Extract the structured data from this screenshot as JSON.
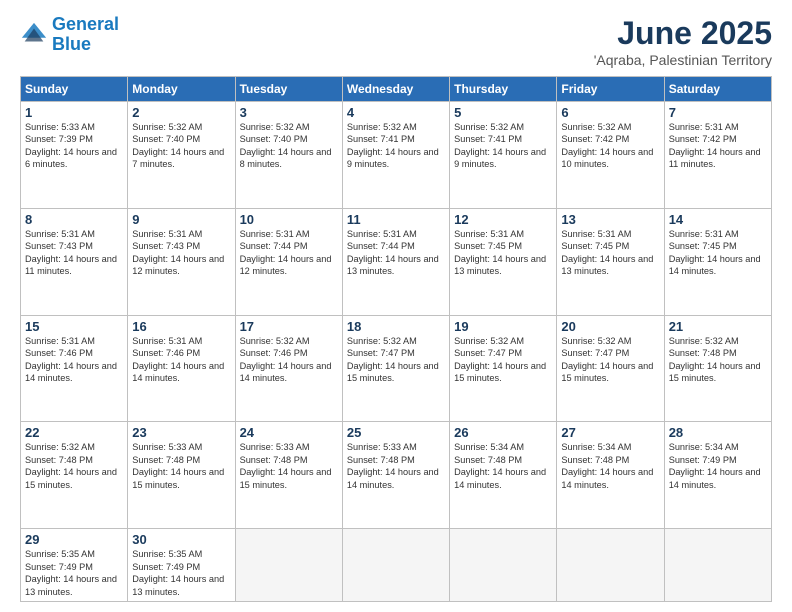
{
  "logo": {
    "line1": "General",
    "line2": "Blue"
  },
  "title": "June 2025",
  "location": "'Aqraba, Palestinian Territory",
  "days_of_week": [
    "Sunday",
    "Monday",
    "Tuesday",
    "Wednesday",
    "Thursday",
    "Friday",
    "Saturday"
  ],
  "weeks": [
    [
      {
        "day": "1",
        "sunrise": "5:33 AM",
        "sunset": "7:39 PM",
        "daylight": "14 hours and 6 minutes."
      },
      {
        "day": "2",
        "sunrise": "5:32 AM",
        "sunset": "7:40 PM",
        "daylight": "14 hours and 7 minutes."
      },
      {
        "day": "3",
        "sunrise": "5:32 AM",
        "sunset": "7:40 PM",
        "daylight": "14 hours and 8 minutes."
      },
      {
        "day": "4",
        "sunrise": "5:32 AM",
        "sunset": "7:41 PM",
        "daylight": "14 hours and 9 minutes."
      },
      {
        "day": "5",
        "sunrise": "5:32 AM",
        "sunset": "7:41 PM",
        "daylight": "14 hours and 9 minutes."
      },
      {
        "day": "6",
        "sunrise": "5:32 AM",
        "sunset": "7:42 PM",
        "daylight": "14 hours and 10 minutes."
      },
      {
        "day": "7",
        "sunrise": "5:31 AM",
        "sunset": "7:42 PM",
        "daylight": "14 hours and 11 minutes."
      }
    ],
    [
      {
        "day": "8",
        "sunrise": "5:31 AM",
        "sunset": "7:43 PM",
        "daylight": "14 hours and 11 minutes."
      },
      {
        "day": "9",
        "sunrise": "5:31 AM",
        "sunset": "7:43 PM",
        "daylight": "14 hours and 12 minutes."
      },
      {
        "day": "10",
        "sunrise": "5:31 AM",
        "sunset": "7:44 PM",
        "daylight": "14 hours and 12 minutes."
      },
      {
        "day": "11",
        "sunrise": "5:31 AM",
        "sunset": "7:44 PM",
        "daylight": "14 hours and 13 minutes."
      },
      {
        "day": "12",
        "sunrise": "5:31 AM",
        "sunset": "7:45 PM",
        "daylight": "14 hours and 13 minutes."
      },
      {
        "day": "13",
        "sunrise": "5:31 AM",
        "sunset": "7:45 PM",
        "daylight": "14 hours and 13 minutes."
      },
      {
        "day": "14",
        "sunrise": "5:31 AM",
        "sunset": "7:45 PM",
        "daylight": "14 hours and 14 minutes."
      }
    ],
    [
      {
        "day": "15",
        "sunrise": "5:31 AM",
        "sunset": "7:46 PM",
        "daylight": "14 hours and 14 minutes."
      },
      {
        "day": "16",
        "sunrise": "5:31 AM",
        "sunset": "7:46 PM",
        "daylight": "14 hours and 14 minutes."
      },
      {
        "day": "17",
        "sunrise": "5:32 AM",
        "sunset": "7:46 PM",
        "daylight": "14 hours and 14 minutes."
      },
      {
        "day": "18",
        "sunrise": "5:32 AM",
        "sunset": "7:47 PM",
        "daylight": "14 hours and 15 minutes."
      },
      {
        "day": "19",
        "sunrise": "5:32 AM",
        "sunset": "7:47 PM",
        "daylight": "14 hours and 15 minutes."
      },
      {
        "day": "20",
        "sunrise": "5:32 AM",
        "sunset": "7:47 PM",
        "daylight": "14 hours and 15 minutes."
      },
      {
        "day": "21",
        "sunrise": "5:32 AM",
        "sunset": "7:48 PM",
        "daylight": "14 hours and 15 minutes."
      }
    ],
    [
      {
        "day": "22",
        "sunrise": "5:32 AM",
        "sunset": "7:48 PM",
        "daylight": "14 hours and 15 minutes."
      },
      {
        "day": "23",
        "sunrise": "5:33 AM",
        "sunset": "7:48 PM",
        "daylight": "14 hours and 15 minutes."
      },
      {
        "day": "24",
        "sunrise": "5:33 AM",
        "sunset": "7:48 PM",
        "daylight": "14 hours and 15 minutes."
      },
      {
        "day": "25",
        "sunrise": "5:33 AM",
        "sunset": "7:48 PM",
        "daylight": "14 hours and 14 minutes."
      },
      {
        "day": "26",
        "sunrise": "5:34 AM",
        "sunset": "7:48 PM",
        "daylight": "14 hours and 14 minutes."
      },
      {
        "day": "27",
        "sunrise": "5:34 AM",
        "sunset": "7:48 PM",
        "daylight": "14 hours and 14 minutes."
      },
      {
        "day": "28",
        "sunrise": "5:34 AM",
        "sunset": "7:49 PM",
        "daylight": "14 hours and 14 minutes."
      }
    ],
    [
      {
        "day": "29",
        "sunrise": "5:35 AM",
        "sunset": "7:49 PM",
        "daylight": "14 hours and 13 minutes."
      },
      {
        "day": "30",
        "sunrise": "5:35 AM",
        "sunset": "7:49 PM",
        "daylight": "14 hours and 13 minutes."
      },
      null,
      null,
      null,
      null,
      null
    ]
  ],
  "labels": {
    "sunrise": "Sunrise:",
    "sunset": "Sunset:",
    "daylight": "Daylight:"
  }
}
